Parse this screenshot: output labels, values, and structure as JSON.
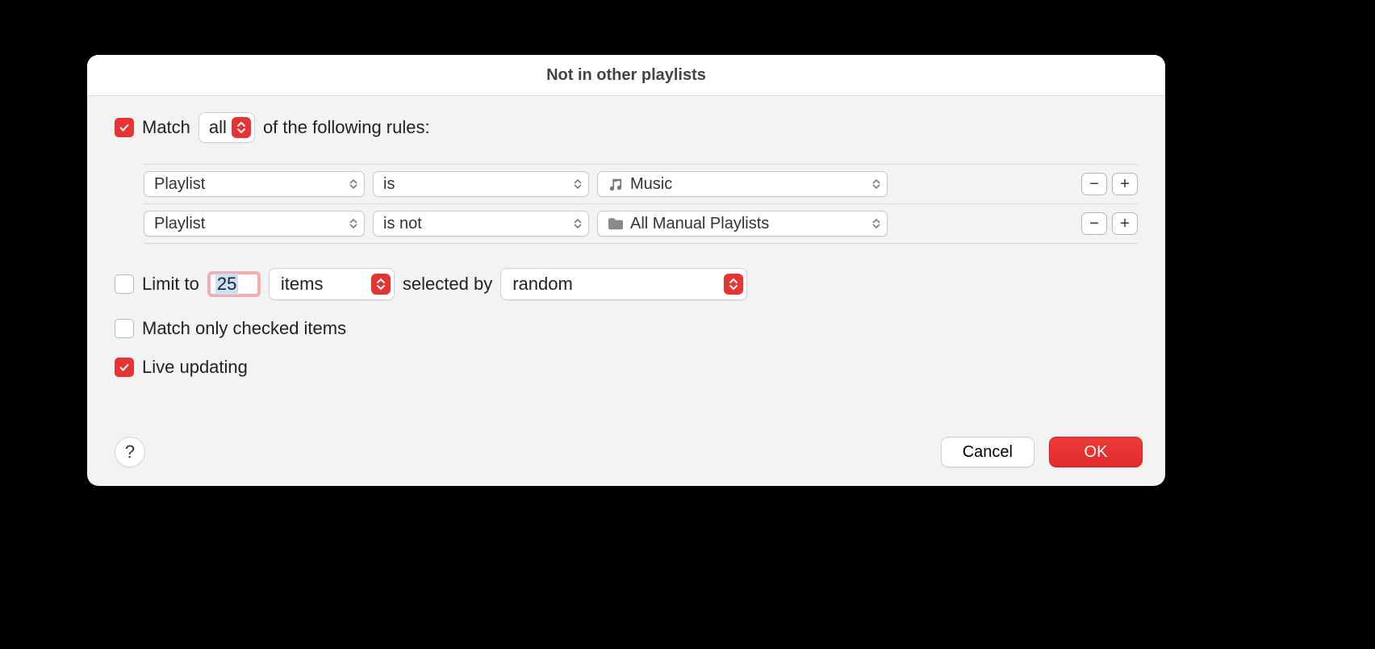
{
  "title": "Not in other playlists",
  "match": {
    "checked": true,
    "prefix": "Match",
    "quantifier": "all",
    "suffix": "of the following rules:"
  },
  "rules": [
    {
      "field": "Playlist",
      "op": "is",
      "valueIcon": "music",
      "value": "Music"
    },
    {
      "field": "Playlist",
      "op": "is not",
      "valueIcon": "folder",
      "value": "All Manual Playlists"
    }
  ],
  "limit": {
    "checked": false,
    "label": "Limit to",
    "count": "25",
    "unit": "items",
    "selected_by_label": "selected by",
    "mode": "random"
  },
  "match_checked": {
    "checked": false,
    "label": "Match only checked items"
  },
  "live_updating": {
    "checked": true,
    "label": "Live updating"
  },
  "footer": {
    "help": "?",
    "cancel": "Cancel",
    "ok": "OK"
  }
}
